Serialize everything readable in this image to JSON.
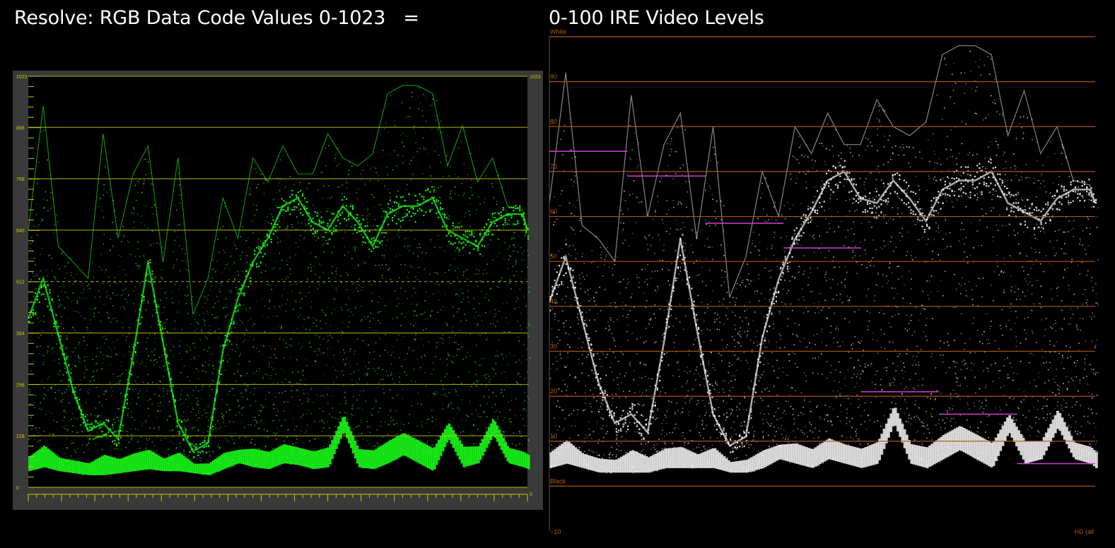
{
  "titles": {
    "left": "Resolve: RGB Data Code Values 0-1023   =",
    "right": "0-100 IRE Video Levels"
  },
  "chart_data": [
    {
      "type": "area",
      "name": "Resolve waveform (RGB data code values)",
      "ylim": [
        0,
        1023
      ],
      "y_ticks": [
        "0",
        "128",
        "256",
        "384",
        "512",
        "640",
        "768",
        "896",
        "1023"
      ],
      "y_tick_values": [
        0,
        128,
        256,
        384,
        512,
        640,
        768,
        896,
        1023
      ],
      "dashed_reference": 512,
      "colors": {
        "trace": "#19ff19",
        "graticule": "#c8c800",
        "frame": "#3a3a3a",
        "label": "#c8c800"
      },
      "x": [
        0,
        3,
        6,
        9,
        12,
        15,
        18,
        21,
        24,
        27,
        30,
        33,
        36,
        39,
        42,
        45,
        48,
        51,
        54,
        57,
        60,
        63,
        66,
        69,
        72,
        75,
        78,
        81,
        84,
        87,
        90,
        93,
        96,
        99,
        100
      ],
      "envelope_top": [
        640,
        950,
        600,
        560,
        520,
        880,
        620,
        780,
        850,
        560,
        820,
        430,
        520,
        720,
        620,
        820,
        760,
        850,
        780,
        780,
        880,
        820,
        800,
        830,
        980,
        1000,
        1000,
        980,
        800,
        900,
        760,
        820,
        700,
        690,
        640
      ],
      "envelope_mid": [
        420,
        520,
        380,
        240,
        140,
        160,
        120,
        330,
        560,
        360,
        160,
        90,
        110,
        340,
        470,
        560,
        620,
        700,
        720,
        660,
        640,
        700,
        660,
        600,
        680,
        700,
        700,
        720,
        640,
        620,
        600,
        660,
        680,
        680,
        640
      ],
      "envelope_bottom": [
        40,
        50,
        40,
        35,
        30,
        30,
        35,
        40,
        45,
        40,
        40,
        35,
        30,
        45,
        60,
        50,
        45,
        60,
        55,
        45,
        50,
        140,
        50,
        45,
        60,
        80,
        60,
        40,
        120,
        50,
        60,
        130,
        60,
        50,
        45
      ]
    },
    {
      "type": "area",
      "name": "Waveform (IRE video levels)",
      "ylim": [
        -10,
        100
      ],
      "y_ticks": [
        "Black",
        "10",
        "20",
        "30",
        "40",
        "50",
        "60",
        "70",
        "80",
        "90",
        "White"
      ],
      "y_tick_values": [
        0,
        10,
        20,
        30,
        40,
        50,
        60,
        70,
        80,
        90,
        100
      ],
      "bottom_label": "−10",
      "corner_label": "HD (all",
      "colors": {
        "trace": "#f2f2f2",
        "graticule": "#b05a10",
        "label": "#b85a14",
        "marker": "#d040d0"
      },
      "x": [
        0,
        3,
        6,
        9,
        12,
        15,
        18,
        21,
        24,
        27,
        30,
        33,
        36,
        39,
        42,
        45,
        48,
        51,
        54,
        57,
        60,
        63,
        66,
        69,
        72,
        75,
        78,
        81,
        84,
        87,
        90,
        93,
        96,
        99,
        100
      ],
      "envelope_top": [
        63,
        92,
        58,
        55,
        50,
        87,
        60,
        76,
        83,
        55,
        80,
        42,
        51,
        70,
        60,
        80,
        74,
        83,
        76,
        76,
        86,
        80,
        78,
        81,
        96,
        98,
        98,
        96,
        78,
        88,
        74,
        80,
        68,
        67,
        63
      ],
      "envelope_mid": [
        41,
        51,
        37,
        23,
        14,
        16,
        12,
        32,
        55,
        35,
        16,
        9,
        11,
        33,
        46,
        55,
        61,
        68,
        70,
        64,
        63,
        68,
        64,
        59,
        66,
        68,
        68,
        70,
        63,
        61,
        59,
        64,
        66,
        66,
        63
      ],
      "envelope_bottom": [
        4,
        5,
        4,
        3,
        3,
        3,
        3,
        4,
        4,
        4,
        4,
        3,
        3,
        4,
        6,
        5,
        4,
        6,
        5,
        4,
        5,
        14,
        5,
        4,
        6,
        8,
        6,
        4,
        12,
        5,
        6,
        13,
        6,
        5,
        4
      ],
      "markers": [
        {
          "x0": 0,
          "x1": 14.3,
          "y": 74.5
        },
        {
          "x0": 14.3,
          "x1": 28.6,
          "y": 69
        },
        {
          "x0": 28.6,
          "x1": 42.9,
          "y": 58.5
        },
        {
          "x0": 42.9,
          "x1": 57.1,
          "y": 53
        },
        {
          "x0": 57.1,
          "x1": 71.4,
          "y": 21
        },
        {
          "x0": 71.4,
          "x1": 85.7,
          "y": 16
        },
        {
          "x0": 85.7,
          "x1": 100,
          "y": 5
        }
      ]
    }
  ]
}
